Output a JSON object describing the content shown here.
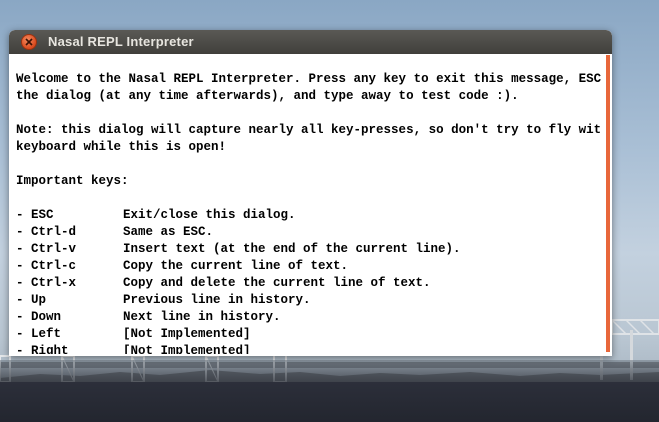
{
  "window": {
    "title": "Nasal REPL Interpreter",
    "close_icon": "close-icon"
  },
  "intro": [
    "Welcome to the Nasal REPL Interpreter. Press any key to exit this message, ESC to exit",
    "the dialog (at any time afterwards), and type away to test code :).",
    "",
    "Note: this dialog will capture nearly all key-presses, so don't try to fly with the",
    "keyboard while this is open!",
    "",
    "Important keys:",
    ""
  ],
  "keys": [
    {
      "key": "- ESC",
      "desc": "Exit/close this dialog."
    },
    {
      "key": "- Ctrl-d",
      "desc": "Same as ESC."
    },
    {
      "key": "- Ctrl-v",
      "desc": "Insert text (at the end of the current line)."
    },
    {
      "key": "- Ctrl-c",
      "desc": "Copy the current line of text."
    },
    {
      "key": "- Ctrl-x",
      "desc": "Copy and delete the current line of text."
    },
    {
      "key": "- Up",
      "desc": "Previous line in history."
    },
    {
      "key": "- Down",
      "desc": "Next line in history."
    },
    {
      "key": "- Left",
      "desc": "[Not Implemented]"
    },
    {
      "key": "- Right",
      "desc": "[Not Implemented]"
    }
  ],
  "colors": {
    "accent": "#e8673a",
    "titlebar": "#4a4945"
  }
}
